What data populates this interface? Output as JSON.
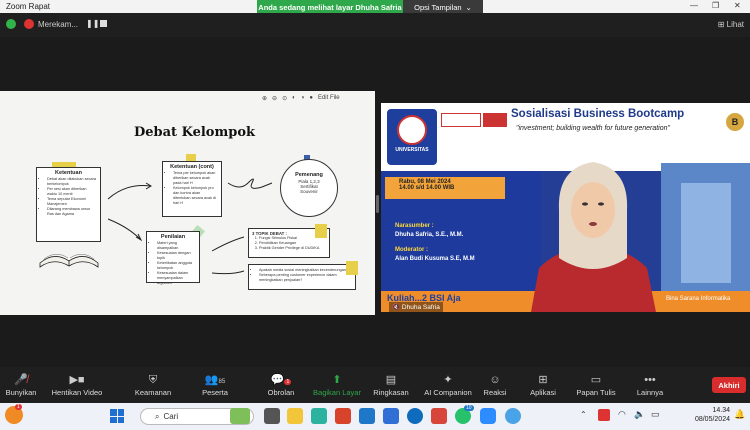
{
  "window": {
    "title": "Zoom Rapat"
  },
  "share_bar": {
    "status": "Anda sedang melihat layar Dhuha Safria",
    "options": "Opsi Tampilan"
  },
  "sub_bar": {
    "recording_label": "Merekam...",
    "view_label": "Lihat"
  },
  "slide": {
    "title": "Debat Kelompok",
    "ketentuan": {
      "title": "Ketentuan",
      "items": [
        "Debat akan dilakukan secara berkelompok",
        "Per sesi akan diberikan waktu 10 menit",
        "Tema seputar Ekonomi Manajemen",
        "Dilarang membawa unsur Ras dan Agama"
      ]
    },
    "ketentuan_cont": {
      "title": "Ketentuan (cont)",
      "items": [
        "Tema per kelompok akan diberikan secara acak pada hari H",
        "Kelompok kelompok pro dan kontra akan ditentukan secara acak di hari H"
      ]
    },
    "pemenang": {
      "title": "Pemenang",
      "items": [
        "Piala 1,2,3",
        "Sertifikat",
        "Souvenir"
      ]
    },
    "penilaian": {
      "title": "Penilaian",
      "items": [
        "Materi yang disampaikan",
        "Kesesuaian dengan topik",
        "Keterlibatan anggota kelompok",
        "Kesesuaian dalam menyampaikan argumen"
      ]
    },
    "topik": {
      "title": "3 TOPIK DEBAT :",
      "items": [
        "Fungsi Stimulus Fiskal",
        "Pendidikan Keuangan",
        "Praktik Gender Privilege di DUDIKA"
      ]
    },
    "questions": [
      "Apakah media sosial meningkatkan kecenderungan?",
      "Seberapa penting customer experience dalam meningkatkan penjualan?"
    ],
    "toolbar": {
      "zoom": "Edit File"
    }
  },
  "video": {
    "banner_title": "Sosialisasi Business Bootcamp",
    "banner_subtitle": "\"investment; building wealth for future generation\"",
    "university": "UNIVERSITAS",
    "event_date": "Rabu, 08 Mei 2024",
    "event_time": "14.00 s/d 14.00 WIB",
    "narasumber_label": "Narasumber :",
    "narasumber_name": "Dhuha Safria, S.E., M.M.",
    "moderator_label": "Moderator :",
    "moderator_name": "Alan Budi Kusuma S.E, M.M",
    "bottom_text": "Kuliah...2 BSI Aja",
    "bottom_right": "Bina Sarana Informatika",
    "participant_name": "Dhuha Safria"
  },
  "toolbar": {
    "items": [
      {
        "label": "Bunyikan",
        "icon": "mic-muted-icon"
      },
      {
        "label": "Hentikan Video",
        "icon": "video-icon"
      },
      {
        "label": "Keamanan",
        "icon": "shield-icon"
      },
      {
        "label": "Peserta",
        "icon": "participants-icon",
        "count": "85"
      },
      {
        "label": "Obrolan",
        "icon": "chat-icon",
        "badge": "1"
      },
      {
        "label": "Bagikan Layar",
        "icon": "share-icon"
      },
      {
        "label": "Ringkasan",
        "icon": "summary-icon"
      },
      {
        "label": "AI Companion",
        "icon": "sparkle-icon"
      },
      {
        "label": "Reaksi",
        "icon": "reaction-icon"
      },
      {
        "label": "Aplikasi",
        "icon": "apps-icon"
      },
      {
        "label": "Papan Tulis",
        "icon": "whiteboard-icon"
      },
      {
        "label": "Lainnya",
        "icon": "more-icon"
      }
    ],
    "end_button": "Akhiri"
  },
  "taskbar": {
    "search_placeholder": "Cari",
    "time": "14.34",
    "date": "08/05/2024",
    "notification_count": "10",
    "start_badge": "1"
  },
  "colors": {
    "accent_green": "#2ea84a",
    "end_red": "#d92d2d",
    "banner_blue": "#1e3a8a"
  }
}
